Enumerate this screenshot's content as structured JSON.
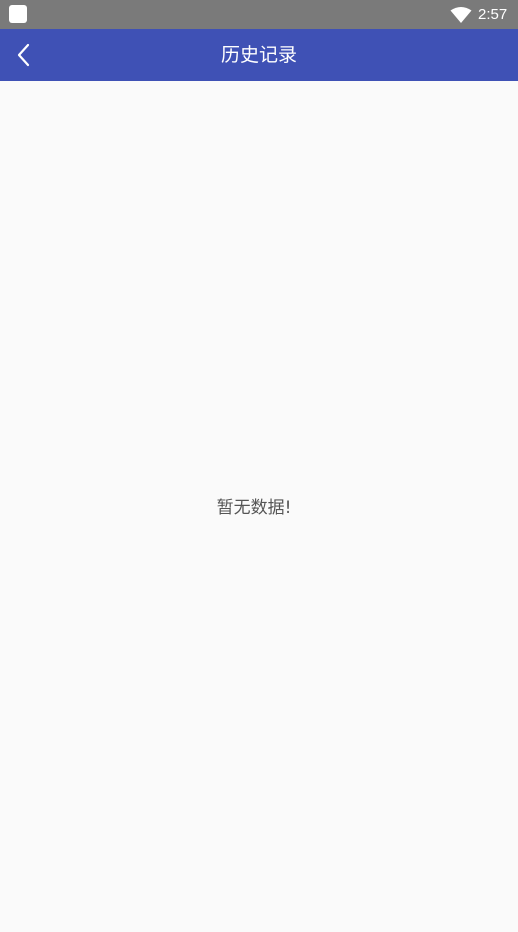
{
  "status_bar": {
    "time": "2:57"
  },
  "app_bar": {
    "title": "历史记录",
    "back_icon": "chevron-left-icon"
  },
  "content": {
    "empty_message": "暂无数据!"
  },
  "colors": {
    "status_bar": "#7a7a7a",
    "app_bar": "#3f51b5",
    "background": "#fafafa",
    "empty_text": "#555555"
  }
}
